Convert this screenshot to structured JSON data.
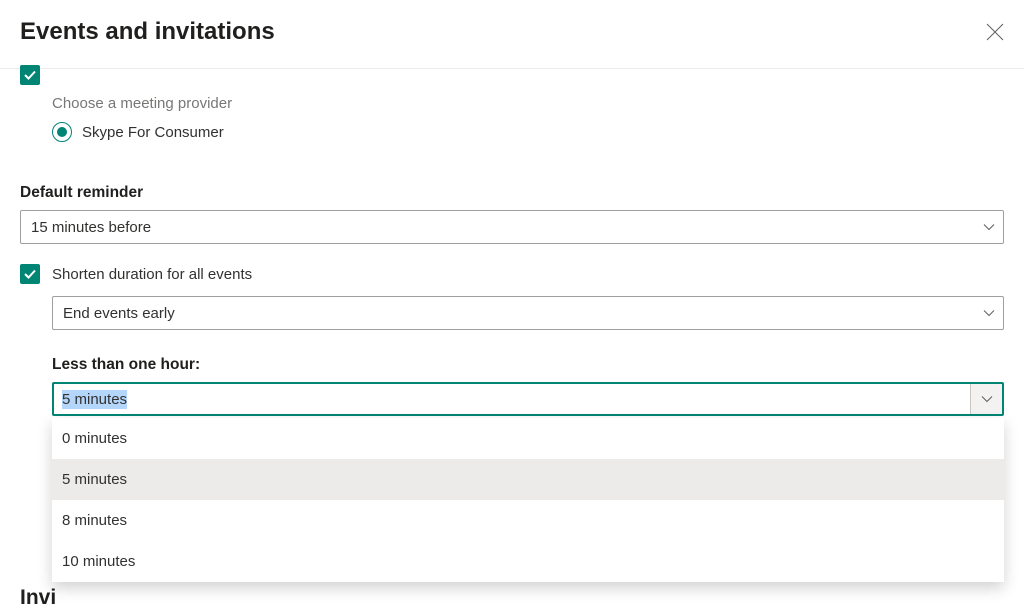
{
  "header": {
    "title": "Events and invitations"
  },
  "meeting_provider": {
    "label": "Choose a meeting provider",
    "selected": "Skype For Consumer"
  },
  "default_reminder": {
    "label": "Default reminder",
    "value": "15 minutes before"
  },
  "shorten": {
    "checkbox_label": "Shorten duration for all events",
    "mode_value": "End events early",
    "less_than_hour": {
      "label": "Less than one hour:",
      "value": "5 minutes",
      "options": [
        "0 minutes",
        "5 minutes",
        "8 minutes",
        "10 minutes"
      ]
    }
  },
  "partial_section": "Invi"
}
